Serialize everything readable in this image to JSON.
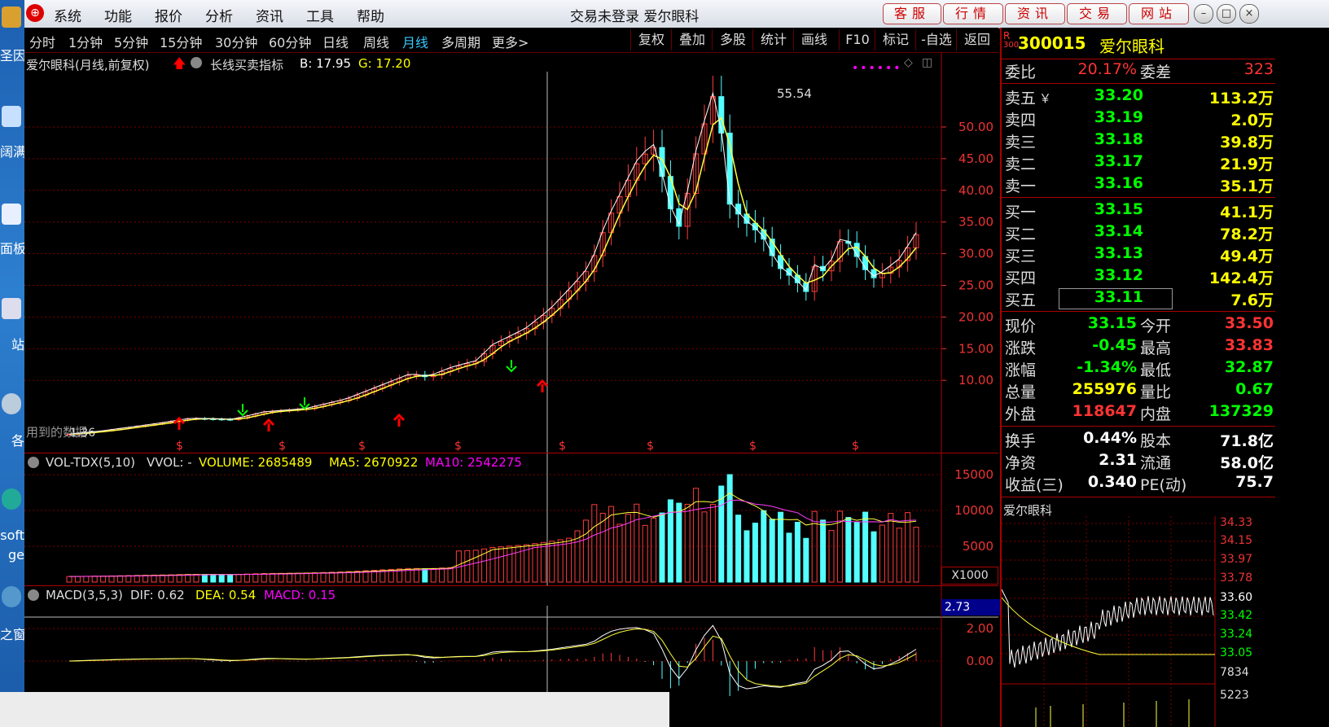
{
  "menu": {
    "items": [
      "系统",
      "功能",
      "报价",
      "分析",
      "资讯",
      "工具",
      "帮助"
    ],
    "title": "交易未登录  爱尔眼科",
    "buttons": [
      "客服",
      "行情",
      "资讯",
      "交易",
      "网站"
    ]
  },
  "desktop": {
    "labels": [
      "圣因",
      "阔满",
      "面板",
      "站",
      "各",
      "soft",
      "ge",
      "之窗"
    ]
  },
  "toolbar": {
    "periods": [
      "分时",
      "1分钟",
      "5分钟",
      "15分钟",
      "30分钟",
      "60分钟",
      "日线",
      "周线",
      "月线",
      "多周期",
      "更多>"
    ],
    "active": "月线",
    "actions": [
      "复权",
      "叠加",
      "多股",
      "统计",
      "画线",
      "F10",
      "标记",
      "-自选",
      "返回"
    ]
  },
  "kline": {
    "title": "爱尔眼科(月线,前复权)",
    "indicator": "长线买卖指标",
    "b_label": "B: 17.95",
    "g_label": "G: 17.20",
    "high_label": "55.54",
    "low_label": "1.36",
    "watermark": "用到的数据",
    "y_ticks": [
      "50.00",
      "45.00",
      "40.00",
      "35.00",
      "30.00",
      "25.00",
      "20.00",
      "15.00",
      "10.00"
    ],
    "s_marker": "$"
  },
  "volume": {
    "title": "VOL-TDX(5,10)",
    "vvol": "VVOL: -",
    "volume_label": "VOLUME: 2685489",
    "ma5_label": "MA5: 2670922",
    "ma10_label": "MA10: 2542275",
    "y_ticks": [
      "15000",
      "10000",
      "5000"
    ],
    "unit": "X1000"
  },
  "macd": {
    "title": "MACD(3,5,3)",
    "dif": "DIF: 0.62",
    "dea": "DEA: 0.54",
    "macd": "MACD: 0.15",
    "cursor_value": "2.73",
    "y_ticks": [
      "2.00",
      "0.00"
    ]
  },
  "quote": {
    "market_tag": "R",
    "market_sub": "300",
    "code": "300015",
    "name": "爱尔眼科",
    "weibi_label": "委比",
    "weibi": "20.17%",
    "weicha_label": "委差",
    "weicha": "323",
    "sells": [
      {
        "label": "卖五",
        "price": "33.20",
        "vol": "113.2万"
      },
      {
        "label": "卖四",
        "price": "33.19",
        "vol": "2.0万"
      },
      {
        "label": "卖三",
        "price": "33.18",
        "vol": "39.8万"
      },
      {
        "label": "卖二",
        "price": "33.17",
        "vol": "21.9万"
      },
      {
        "label": "卖一",
        "price": "33.16",
        "vol": "35.1万"
      }
    ],
    "yen_mark": "￥",
    "buys": [
      {
        "label": "买一",
        "price": "33.15",
        "vol": "41.1万"
      },
      {
        "label": "买二",
        "price": "33.14",
        "vol": "78.2万"
      },
      {
        "label": "买三",
        "price": "33.13",
        "vol": "49.4万"
      },
      {
        "label": "买四",
        "price": "33.12",
        "vol": "142.4万"
      },
      {
        "label": "买五",
        "price": "33.11",
        "vol": "7.6万"
      }
    ],
    "stats": [
      {
        "l1": "现价",
        "v1": "33.15",
        "l2": "今开",
        "v2": "33.50"
      },
      {
        "l1": "涨跌",
        "v1": "-0.45",
        "l2": "最高",
        "v2": "33.83"
      },
      {
        "l1": "涨幅",
        "v1": "-1.34%",
        "l2": "最低",
        "v2": "32.87"
      },
      {
        "l1": "总量",
        "v1": "255976",
        "l2": "量比",
        "v2": "0.67"
      },
      {
        "l1": "外盘",
        "v1": "118647",
        "l2": "内盘",
        "v2": "137329"
      }
    ],
    "stats2": [
      {
        "l1": "换手",
        "v1": "0.44%",
        "l2": "股本",
        "v2": "71.8亿"
      },
      {
        "l1": "净资",
        "v1": "2.31",
        "l2": "流通",
        "v2": "58.0亿"
      },
      {
        "l1": "收益(三)",
        "v1": "0.340",
        "l2": "PE(动)",
        "v2": "75.7"
      }
    ],
    "mini_title": "爱尔眼科",
    "mini_ticks": [
      "34.33",
      "34.15",
      "33.97",
      "33.78",
      "33.60",
      "33.42",
      "33.24",
      "33.05"
    ],
    "mini_vol": "7834",
    "mini_vol2": "5223"
  },
  "colors": {
    "up": "#ff3b3b",
    "down": "#54ffff",
    "ma5": "#ffff3c",
    "ma10": "#ff3cff",
    "green": "#00ff00",
    "grid": "#7a0000"
  }
}
